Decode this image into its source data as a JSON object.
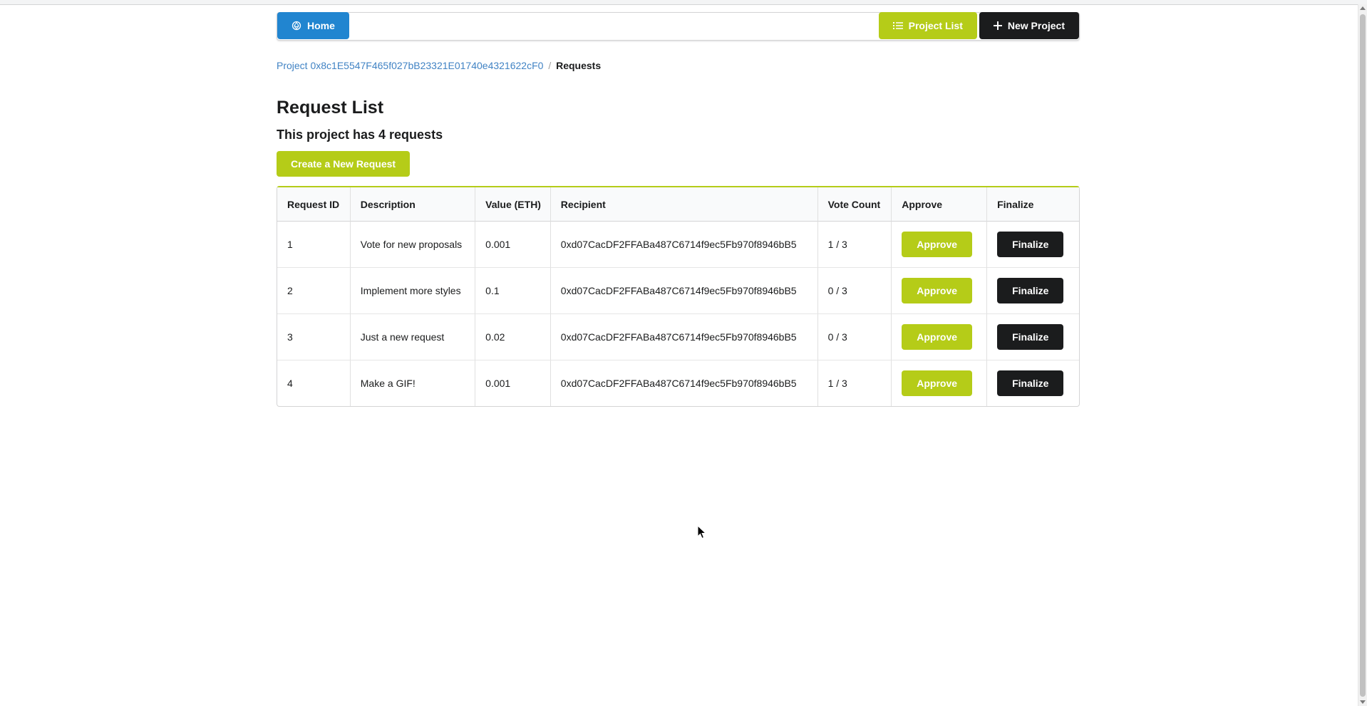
{
  "nav": {
    "home_label": "Home",
    "project_list_label": "Project List",
    "new_project_label": "New Project",
    "home_icon": "ethereum-icon",
    "project_list_icon": "list-icon",
    "new_project_icon": "plus-icon"
  },
  "breadcrumb": {
    "project_link": "Project 0x8c1E5547F465f027bB23321E01740e4321622cF0",
    "divider": "/",
    "current": "Requests"
  },
  "page": {
    "title": "Request List",
    "subtitle": "This project has 4 requests",
    "create_button": "Create a New Request"
  },
  "table": {
    "headers": {
      "id": "Request ID",
      "description": "Description",
      "value": "Value (ETH)",
      "recipient": "Recipient",
      "votes": "Vote Count",
      "approve": "Approve",
      "finalize": "Finalize"
    },
    "rows": [
      {
        "id": "1",
        "description": "Vote for new proposals",
        "value": "0.001",
        "recipient": "0xd07CacDF2FFABa487C6714f9ec5Fb970f8946bB5",
        "votes": "1 / 3",
        "approve": "Approve",
        "finalize": "Finalize"
      },
      {
        "id": "2",
        "description": "Implement more styles",
        "value": "0.1",
        "recipient": "0xd07CacDF2FFABa487C6714f9ec5Fb970f8946bB5",
        "votes": "0 / 3",
        "approve": "Approve",
        "finalize": "Finalize"
      },
      {
        "id": "3",
        "description": "Just a new request",
        "value": "0.02",
        "recipient": "0xd07CacDF2FFABa487C6714f9ec5Fb970f8946bB5",
        "votes": "0 / 3",
        "approve": "Approve",
        "finalize": "Finalize"
      },
      {
        "id": "4",
        "description": "Make a GIF!",
        "value": "0.001",
        "recipient": "0xd07CacDF2FFABa487C6714f9ec5Fb970f8946bB5",
        "votes": "1 / 3",
        "approve": "Approve",
        "finalize": "Finalize"
      }
    ]
  },
  "colors": {
    "primary_blue": "#2185d0",
    "olive": "#b5cc18",
    "black": "#1b1c1d",
    "link": "#4183c4"
  }
}
